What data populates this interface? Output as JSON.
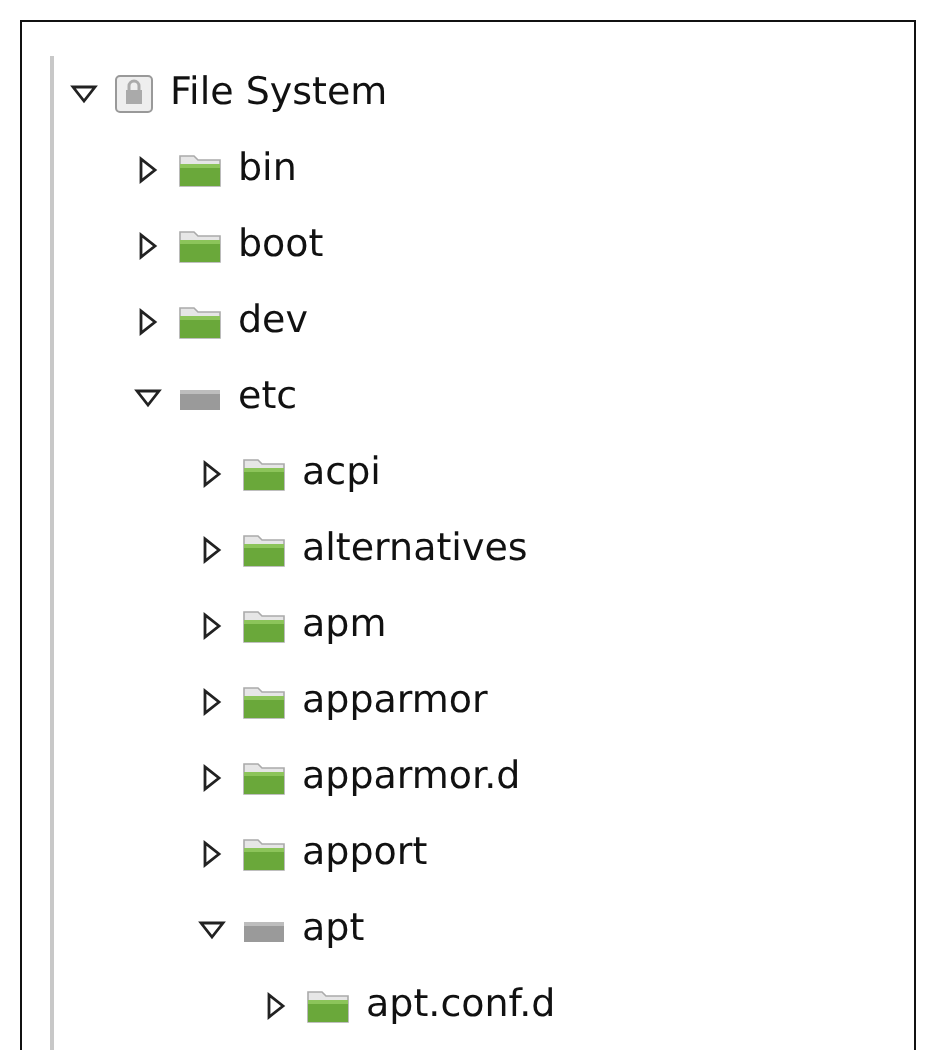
{
  "tree": [
    {
      "label": "File System",
      "kind": "drive",
      "expanded": true,
      "children": [
        {
          "label": "bin",
          "kind": "folder",
          "expanded": false
        },
        {
          "label": "boot",
          "kind": "folder",
          "expanded": false
        },
        {
          "label": "dev",
          "kind": "folder",
          "expanded": false
        },
        {
          "label": "etc",
          "kind": "folder",
          "expanded": true,
          "children": [
            {
              "label": "acpi",
              "kind": "folder",
              "expanded": false
            },
            {
              "label": "alternatives",
              "kind": "folder",
              "expanded": false
            },
            {
              "label": "apm",
              "kind": "folder",
              "expanded": false
            },
            {
              "label": "apparmor",
              "kind": "folder",
              "expanded": false
            },
            {
              "label": "apparmor.d",
              "kind": "folder",
              "expanded": false
            },
            {
              "label": "apport",
              "kind": "folder",
              "expanded": false
            },
            {
              "label": "apt",
              "kind": "folder",
              "expanded": true,
              "children": [
                {
                  "label": "apt.conf.d",
                  "kind": "folder",
                  "expanded": false
                }
              ]
            }
          ]
        }
      ]
    }
  ]
}
